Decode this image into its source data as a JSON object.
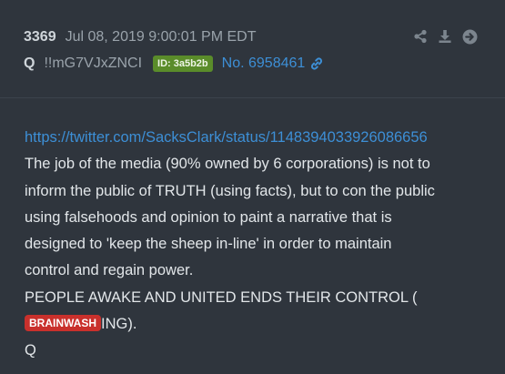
{
  "post": {
    "number": "3369",
    "date": "Jul 08, 2019 9:00:01 PM EDT",
    "author": "Q",
    "tripcode": "!!mG7VJxZNCI",
    "id_badge": "ID: 3a5b2b",
    "post_no": "No. 6958461"
  },
  "icons": {
    "link": "link-icon",
    "share": "share-icon",
    "download": "download-icon",
    "goto": "arrow-circle-right-icon"
  },
  "body": {
    "link_url": "https://twitter.com/SacksClark/status/1148394033926086656",
    "line1": "The job of the media (90% owned by 6 corporations) is not to",
    "line2": "inform the public of TRUTH (using facts), but to con the public",
    "line3": "using falsehoods and opinion to paint a narrative that is",
    "line4": "designed to 'keep the sheep in-line' in order to maintain",
    "line5": "control and regain power.",
    "line6": "PEOPLE AWAKE AND UNITED ENDS THEIR CONTROL (",
    "brainwash_label": "BRAINWASH",
    "line7_suffix": "ING).",
    "signature": "Q"
  },
  "colors": {
    "background": "#2f353d",
    "link": "#3d8fd6",
    "id_badge": "#5a8c2a",
    "brainwash_badge": "#c9302c"
  }
}
